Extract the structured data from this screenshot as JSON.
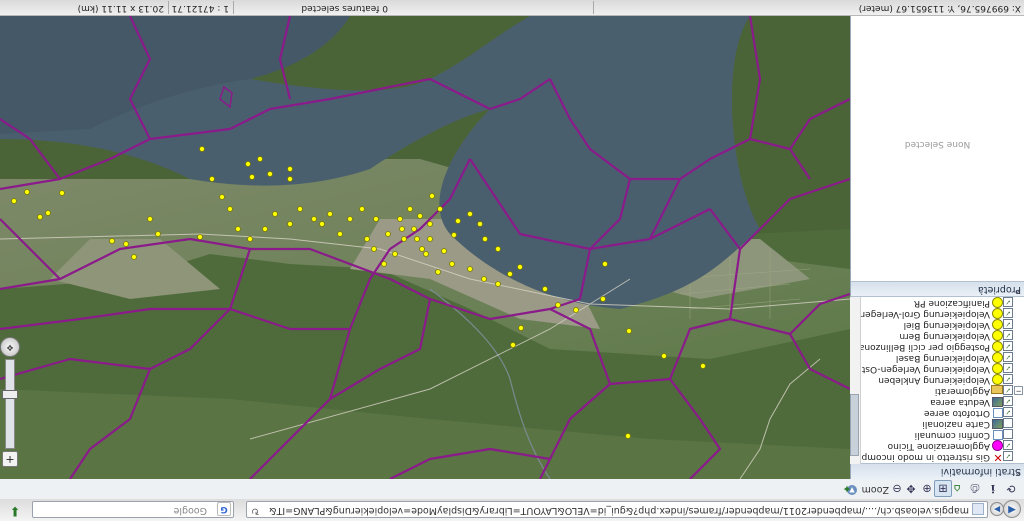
{
  "browser": {
    "url": "http://map.geo.admin.ch/?Y=713000&X=113000&zoom=2&lang=it&layers=ch.swisstopo.fixpunkte-agnes,ch.are.agglomerationen_isolierte_staedte&bgLayer=voidLayer",
    "url_display": "mapgis.veloasb.ch/..../mapbender2011/mapbender/frames/index.php?&gui_id=VELO&LAYOUT=Library&DisplayMode=velopiekierung&PLANG=IT&x=&y=&scale=",
    "search_placeholder": "Google",
    "go_glyph": "↻"
  },
  "tools": {
    "zoom_label": "Zoom"
  },
  "layers_panel": {
    "title": "Strati informativi",
    "items": [
      {
        "label": "Gis ristretto in modo incompleto",
        "symbol": "x",
        "checked": true
      },
      {
        "label": "Agglomerazione Ticino",
        "symbol": "magenta",
        "checked": true
      },
      {
        "label": "Confini comunali",
        "symbol": "box",
        "checked": false
      },
      {
        "label": "Carte nazionali",
        "symbol": "img",
        "checked": false
      },
      {
        "label": "Ortofoto aeree",
        "symbol": "box",
        "checked": true
      },
      {
        "label": "Veduta aerea",
        "symbol": "img",
        "checked": true
      },
      {
        "label": "Agglomerati",
        "symbol": "folder",
        "checked": true
      },
      {
        "label": "Velopiekierung Ankleben",
        "symbol": "yellow",
        "checked": true
      },
      {
        "label": "Velopiekierung Verlegen-Ost",
        "symbol": "yellow",
        "checked": true
      },
      {
        "label": "Velopiekierung Basel",
        "symbol": "yellow",
        "checked": true
      },
      {
        "label": "Posteggio per cicli Bellinzona",
        "symbol": "yellow",
        "checked": true
      },
      {
        "label": "Velopiekierung Bern",
        "symbol": "yellow",
        "checked": true
      },
      {
        "label": "Velopiekierung Biel",
        "symbol": "yellow",
        "checked": true
      },
      {
        "label": "Velopiekierung Grol-Verlegen",
        "symbol": "yellow",
        "checked": true
      },
      {
        "label": "Pianificazione PR",
        "symbol": "yellow",
        "checked": true
      }
    ]
  },
  "properties_panel": {
    "title": "Proprietà",
    "empty_text": "None Selected"
  },
  "status": {
    "coords": "X: 699765.76, Y: 113651.67 (meter)",
    "selection": "0 features selected",
    "scale": "1 : 47121.71",
    "size": "20.13 x 11.11 (km)"
  },
  "colors": {
    "boundary": "#8b1a8b",
    "point_fill": "#ffff00",
    "lake": "#4a5f6e"
  },
  "icons": [
    "back-icon",
    "forward-icon",
    "home-icon",
    "zoom-in-icon",
    "zoom-out-icon",
    "pan-icon",
    "info-icon",
    "print-icon",
    "refresh-icon",
    "google-icon",
    "download-icon"
  ]
}
